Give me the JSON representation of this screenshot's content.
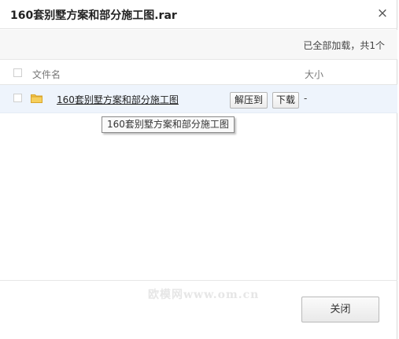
{
  "dialog": {
    "title": "160套别墅方案和部分施工图.rar",
    "close_glyph": "×",
    "close_icon": "close-icon"
  },
  "status": {
    "text": "已全部加载，共1个"
  },
  "table": {
    "columns": [
      "文件名",
      "大小"
    ],
    "rows": [
      {
        "icon": "folder-icon",
        "name": "160套别墅方案和部分施工图",
        "size": "-",
        "actions": [
          "解压到",
          "下载"
        ]
      }
    ]
  },
  "tooltip": {
    "text": "160套别墅方案和部分施工图"
  },
  "footer": {
    "watermark": "欧模网www.om.cn",
    "close_button": "关闭"
  },
  "colors": {
    "selected_row": "#eef4fc",
    "folder": "#f2c34a",
    "title": "#222222"
  }
}
